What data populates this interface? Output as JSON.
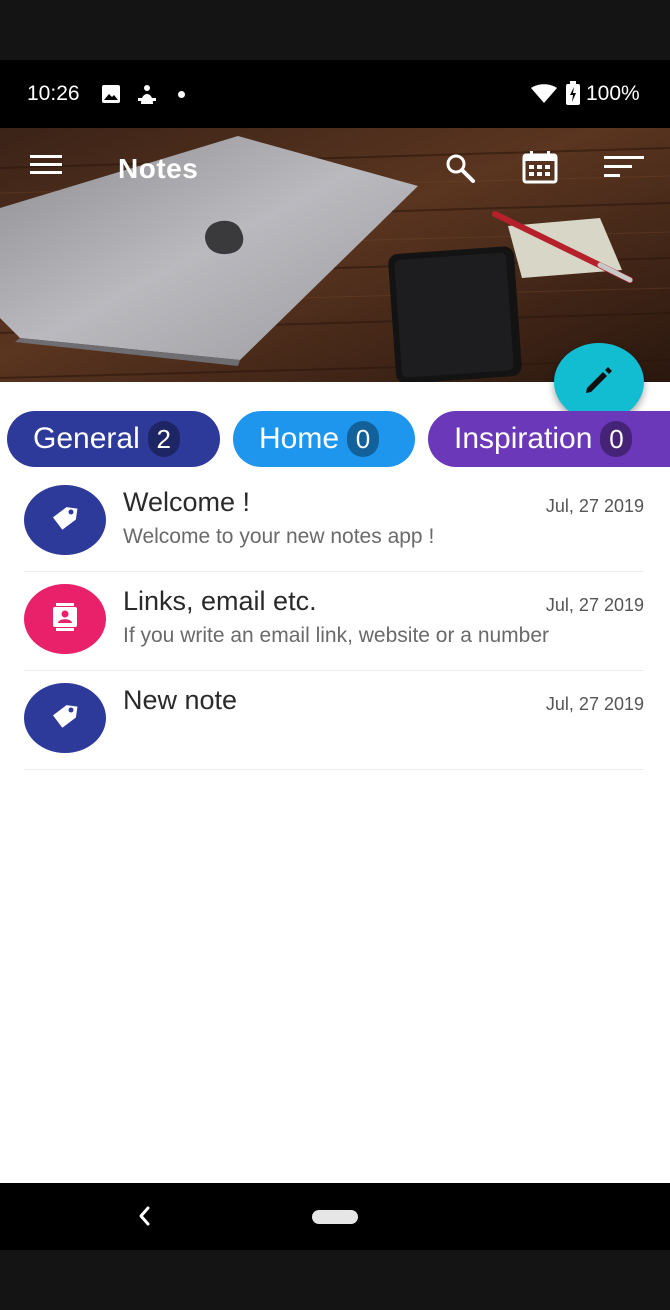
{
  "status_bar": {
    "time": "10:26",
    "battery": "100%"
  },
  "header": {
    "title": "Notes"
  },
  "chips": [
    {
      "label": "General",
      "count": "2",
      "color": "#2e3a9a"
    },
    {
      "label": "Home",
      "count": "0",
      "color": "#1e96ee"
    },
    {
      "label": "Inspiration",
      "count": "0",
      "color": "#6a38b8"
    }
  ],
  "notes": [
    {
      "title": "Welcome !",
      "date": "Jul, 27 2019",
      "preview": "Welcome to your new notes app !",
      "icon": "tag-icon",
      "color": "#2e3a9a"
    },
    {
      "title": "Links, email etc.",
      "date": "Jul, 27 2019",
      "preview": "If you write an email link, website or a number",
      "icon": "contact-card-icon",
      "color": "#e9216a"
    },
    {
      "title": "New note",
      "date": "Jul, 27 2019",
      "preview": "",
      "icon": "tag-icon",
      "color": "#2e3a9a"
    }
  ],
  "colors": {
    "fab": "#12bcd1",
    "accent_blue": "#2e3a9a",
    "accent_pink": "#e9216a"
  }
}
